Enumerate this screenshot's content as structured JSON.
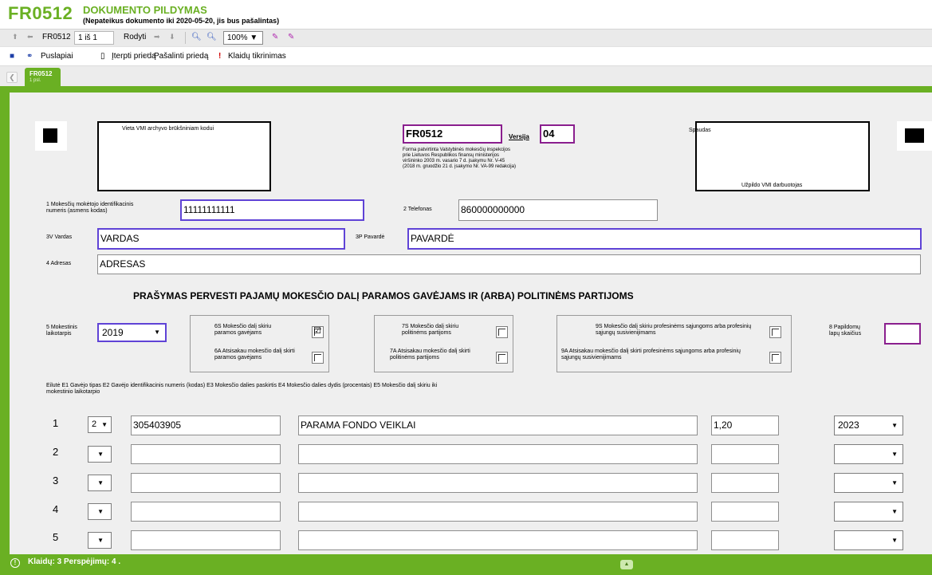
{
  "header": {
    "code": "FR0512",
    "title": "DOKUMENTO PILDYMAS",
    "subtitle": "(Nepateikus dokumento iki 2020-05-20, jis bus pašalintas)"
  },
  "toolbar": {
    "doc_code": "FR0512",
    "page_counter": "1 iš 1",
    "show_label": "Rodyti",
    "zoom": "100%"
  },
  "actions": {
    "pages": "Puslapiai",
    "insert": "Įterpti priedą",
    "remove": "Pašalinti priedą",
    "check": "Klaidų tikrinimas"
  },
  "tab": {
    "code": "FR0512",
    "page": "1 psl."
  },
  "form": {
    "vmi_archive_label": "Vieta VMI archyvo brūkšniniam kodui",
    "form_code": "FR0512",
    "version_label": "Versija",
    "version_value": "04",
    "approval_lines": [
      "Forma patvirtinta Valstybinės mokesčių inspekcijos",
      "prie Lietuvos Respublikos finansų ministerijos",
      "viršininko 2003 m. vasario 7 d. įsakymu Nr. V-45",
      "(2018 m. gruodžio 21 d. įsakymo Nr. VA-99 redakcija)"
    ],
    "stamp_label": "Spaudas",
    "vmi_fills_label": "Užpildo VMI darbuotojas",
    "f1_label_l1": "1 Mokesčių mokėtojo identifikacinis",
    "f1_label_l2": "numeris (asmens kodas)",
    "f1_value": "11111111111",
    "f2_label": "2 Telefonas",
    "f2_value": "860000000000",
    "f3v_label": "3V Vardas",
    "f3v_value": "VARDAS",
    "f3p_label": "3P Pavardė",
    "f3p_value": "PAVARDĖ",
    "f4_label": "4 Adresas",
    "f4_value": "ADRESAS",
    "main_title": "PRAŠYMAS PERVESTI PAJAMŲ MOKESČIO DALĮ PARAMOS GAVĖJAMS IR (ARBA) POLITINĖMS PARTIJOMS",
    "f5_label_l1": "5 Mokestinis",
    "f5_label_l2": "laikotarpis",
    "f5_value": "2019",
    "f6s_l1": "6S Mokesčio dalį skiriu",
    "f6s_l2": "paramos gavėjams",
    "f6a_l1": "6A Atsisakau mokesčio dalį skirti",
    "f6a_l2": "paramos gavėjams",
    "f7s_l1": "7S Mokesčio dalį skiriu",
    "f7s_l2": "politinėms partijoms",
    "f7a_l1": "7A Atsisakau mokesčio dalį skirti",
    "f7a_l2": "politinėms partijoms",
    "f9s_l1": "9S Mokesčio dalį skiriu profesinėms sąjungoms arba profesinių",
    "f9s_l2": "sąjungų susivienijimams",
    "f9a_l1": "9A Atsisakau mokesčio dalį skirti profesinėms sąjungoms arba profesinių",
    "f9a_l2": "sąjungų susivienijimams",
    "f8_label_l1": "8 Papildomų",
    "f8_label_l2": "lapų skaičius",
    "f6s_checked": true,
    "table_header_l1": "Eilutė E1 Gavėjo tipas E2 Gavėjo identifikacinis numeris (kodas) E3 Mokesčio dalies paskirtis E4 Mokesčio dalies dydis (procentais) E5 Mokesčio dalį skiriu iki",
    "table_header_l2": "mokestinio laikotarpio",
    "rows": [
      {
        "num": "1",
        "type": "2",
        "code": "305403905",
        "purpose": "PARAMA FONDO VEIKLAI",
        "percent": "1,20",
        "year": "2023"
      },
      {
        "num": "2",
        "type": "",
        "code": "",
        "purpose": "",
        "percent": "",
        "year": ""
      },
      {
        "num": "3",
        "type": "",
        "code": "",
        "purpose": "",
        "percent": "",
        "year": ""
      },
      {
        "num": "4",
        "type": "",
        "code": "",
        "purpose": "",
        "percent": "",
        "year": ""
      },
      {
        "num": "5",
        "type": "",
        "code": "",
        "purpose": "",
        "percent": "",
        "year": ""
      }
    ]
  },
  "status": {
    "text": "Klaidų: 3 Perspėjimų: 4 ."
  },
  "colors": {
    "accent": "#6ab023",
    "field_blue": "#5f43d6",
    "field_purple": "#8a1f8e"
  }
}
